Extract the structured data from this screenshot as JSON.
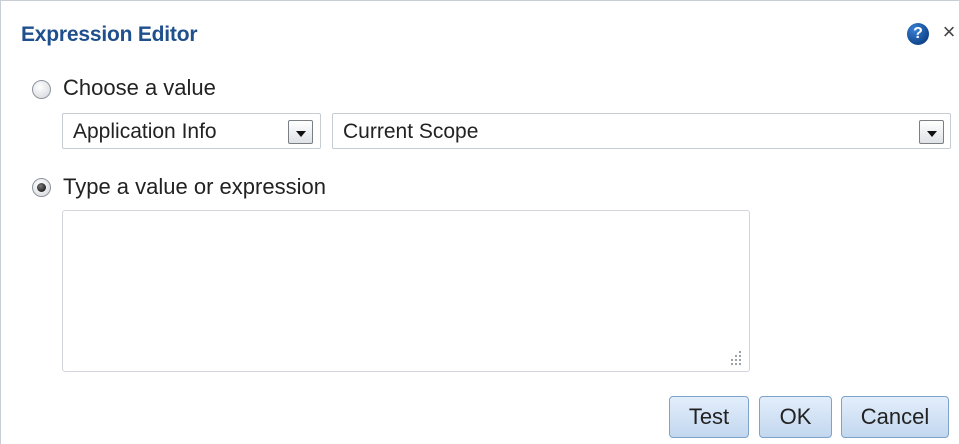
{
  "dialog": {
    "title": "Expression Editor",
    "help_glyph": "?",
    "close_glyph": "×"
  },
  "choose": {
    "label": "Choose a value",
    "checked": false,
    "category": {
      "value": "Application Info"
    },
    "scope": {
      "value": "Current Scope"
    }
  },
  "type_expression": {
    "label": "Type a value or expression",
    "checked": true,
    "value": ""
  },
  "buttons": {
    "test": "Test",
    "ok": "OK",
    "cancel": "Cancel"
  },
  "icons": {
    "help": "help-icon",
    "close": "close-icon",
    "dropdown": "chevron-down-icon",
    "resize": "resize-grip-icon"
  },
  "colors": {
    "title": "#1f4f8c",
    "button_top": "#e3eefb",
    "button_bottom": "#c2d7ef",
    "help_icon": "#1b5aa8"
  }
}
